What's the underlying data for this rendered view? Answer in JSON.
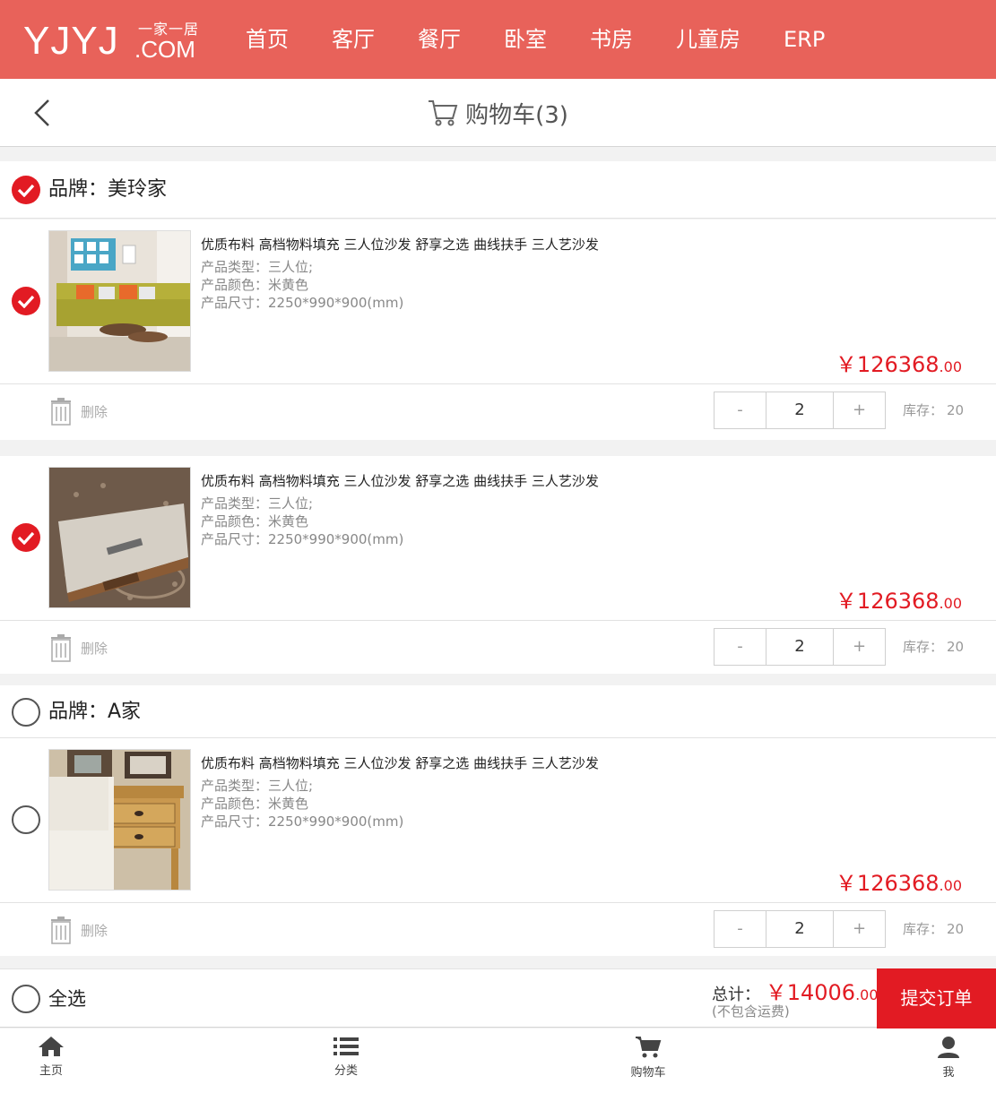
{
  "nav": {
    "logo_main": "YJYJ",
    "logo_cn": "一家一居",
    "logo_com": ".COM",
    "items": [
      "首页",
      "客厅",
      "餐厅",
      "卧室",
      "书房",
      "儿童房",
      "ERP"
    ]
  },
  "header": {
    "title": "购物车(3)"
  },
  "brands": [
    {
      "label": "品牌：美玲家",
      "checked": true
    },
    {
      "label": "品牌：A家",
      "checked": false
    }
  ],
  "items": [
    {
      "name": "优质布料 高档物料填充 三人位沙发 舒享之选 曲线扶手 三人艺沙发",
      "type": "产品类型：三人位;",
      "color": "产品颜色：米黄色",
      "size": "产品尺寸：2250*990*900(mm)",
      "price_int": "￥126368",
      "price_dec": ".00",
      "delete_label": "删除",
      "minus": "-",
      "qty": "2",
      "plus": "+",
      "stock_label": "库存：",
      "stock_value": "20",
      "checked": true
    },
    {
      "name": "优质布料 高档物料填充 三人位沙发 舒享之选 曲线扶手 三人艺沙发",
      "type": "产品类型：三人位;",
      "color": "产品颜色：米黄色",
      "size": "产品尺寸：2250*990*900(mm)",
      "price_int": "￥126368",
      "price_dec": ".00",
      "delete_label": "删除",
      "minus": "-",
      "qty": "2",
      "plus": "+",
      "stock_label": "库存：",
      "stock_value": "20",
      "checked": true
    },
    {
      "name": "优质布料 高档物料填充 三人位沙发 舒享之选 曲线扶手 三人艺沙发",
      "type": "产品类型：三人位;",
      "color": "产品颜色：米黄色",
      "size": "产品尺寸：2250*990*900(mm)",
      "price_int": "￥126368",
      "price_dec": ".00",
      "delete_label": "删除",
      "minus": "-",
      "qty": "2",
      "plus": "+",
      "stock_label": "库存：",
      "stock_value": "20",
      "checked": false
    }
  ],
  "summary": {
    "select_all": "全选",
    "total_label": "总计：",
    "total_int": "￥14006",
    "total_dec": ".00",
    "note": "(不包含运费)",
    "submit": "提交订单"
  },
  "tabbar": [
    "主页",
    "分类",
    "购物车",
    "我"
  ],
  "colors": {
    "nav_bg": "#e8625a",
    "accent": "#e21b23"
  }
}
